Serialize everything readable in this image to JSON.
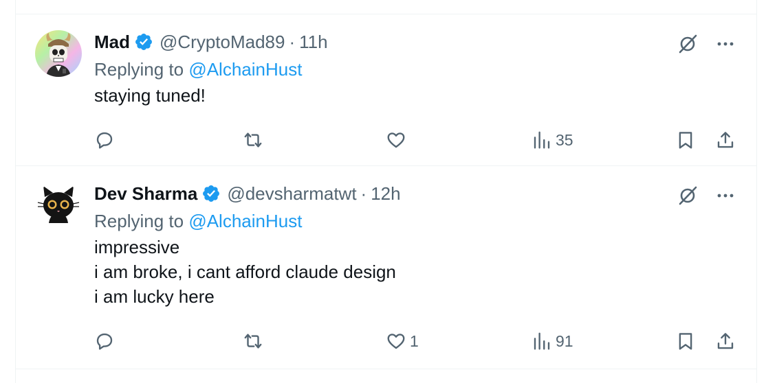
{
  "tweets": [
    {
      "display_name": "Mad",
      "handle": "@CryptoMad89",
      "separator": "·",
      "time": "11h",
      "replying_prefix": "Replying to",
      "replying_handle": "@AlchainHust",
      "text_lines": [
        "staying tuned!"
      ],
      "stats": {
        "replies": "",
        "retweets": "",
        "likes": "",
        "views": "35"
      },
      "avatar_icon": "skull-viking-avatar"
    },
    {
      "display_name": "Dev Sharma",
      "handle": "@devsharmatwt",
      "separator": "·",
      "time": "12h",
      "replying_prefix": "Replying to",
      "replying_handle": "@AlchainHust",
      "text_lines": [
        "impressive",
        "i am broke, i cant afford claude design",
        "i am lucky here"
      ],
      "stats": {
        "replies": "",
        "retweets": "",
        "likes": "1",
        "views": "91"
      },
      "avatar_icon": "black-cat-avatar"
    }
  ],
  "icons": {
    "verified": "verified-badge-icon",
    "grok": "grok-icon",
    "more": "more-icon",
    "reply": "reply-icon",
    "retweet": "retweet-icon",
    "like": "like-icon",
    "views": "views-icon",
    "bookmark": "bookmark-icon",
    "share": "share-icon"
  },
  "colors": {
    "accent": "#1d9bf0",
    "text_primary": "#0f1419",
    "text_secondary": "#536471",
    "divider": "#eff3f4"
  }
}
